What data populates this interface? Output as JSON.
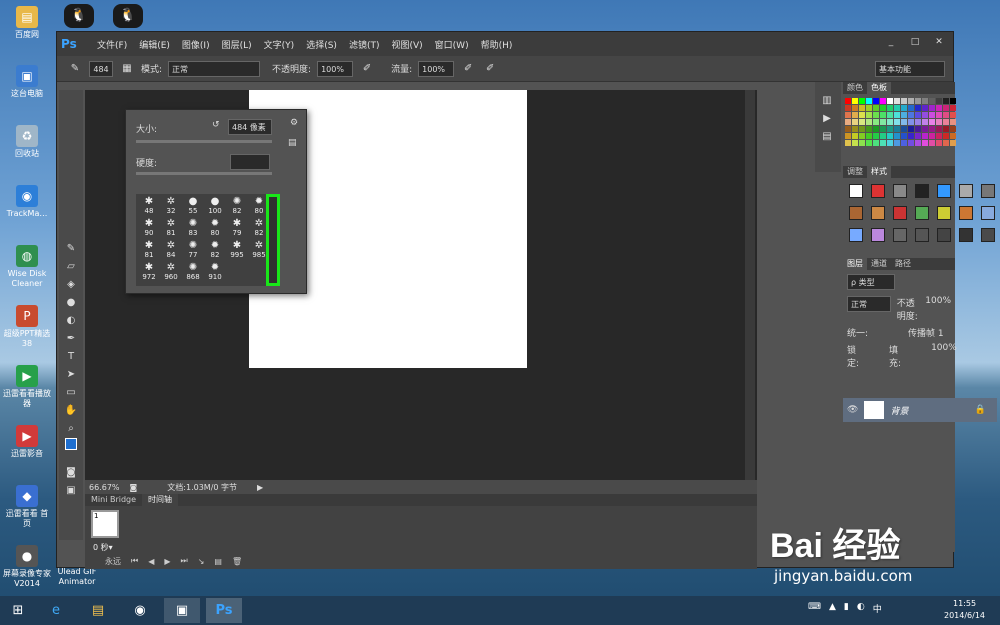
{
  "desktop": {
    "top_icons": [
      "qq-icon",
      "qq-icon"
    ],
    "icons": [
      {
        "label": "百度网",
        "icon": "folder-icon"
      },
      {
        "label": "这台电脑",
        "icon": "computer-icon"
      },
      {
        "label": "回收站",
        "icon": "recycle-bin-icon"
      },
      {
        "label": "TrackMa…",
        "icon": "app-icon"
      },
      {
        "label": "Wise Disk Cleaner",
        "icon": "app-icon"
      },
      {
        "label": "超级PPT精选 38",
        "icon": "app-icon"
      },
      {
        "label": "迅雷看看播放器",
        "icon": "app-icon"
      },
      {
        "label": "迅雷影音",
        "icon": "app-icon"
      },
      {
        "label": "迅雷看看 首页",
        "icon": "app-icon"
      },
      {
        "label": "屏幕录像专家 V2014",
        "icon": "app-icon"
      },
      {
        "label": "Ulead GIF Animator",
        "icon": "app-icon"
      }
    ]
  },
  "ps": {
    "logo": "Ps",
    "menus": [
      "文件(F)",
      "编辑(E)",
      "图像(I)",
      "图层(L)",
      "文字(Y)",
      "选择(S)",
      "滤镜(T)",
      "视图(V)",
      "窗口(W)",
      "帮助(H)"
    ],
    "window_controls": [
      "_",
      "□",
      "✕"
    ],
    "options": {
      "brush_size": "484",
      "mode_label": "模式:",
      "mode_value": "正常",
      "opacity_label": "不透明度:",
      "opacity_value": "100%",
      "flow_label": "流量:",
      "flow_value": "100%",
      "workspace": "基本功能"
    },
    "brush_popup": {
      "size_label": "大小:",
      "size_value": "484 像素",
      "hardness_label": "硬度:",
      "brushes": [
        "48",
        "32",
        "55",
        "100",
        "82",
        "80",
        "90",
        "81",
        "83",
        "80",
        "79",
        "82",
        "81",
        "84",
        "77",
        "82",
        "995",
        "985",
        "972",
        "960",
        "868",
        "910"
      ]
    },
    "status": {
      "zoom": "66.67%",
      "doc": "文档:1.03M/0 字节"
    },
    "bottom_tabs": [
      "Mini Bridge",
      "时间轴"
    ],
    "timeline": {
      "frame_num": "1",
      "delay": "0 秒▾",
      "loop": "永远"
    },
    "right": {
      "color_tabs": [
        "颜色",
        "色板"
      ],
      "adjust_tabs": [
        "调整",
        "样式"
      ],
      "layer_tabs": [
        "图层",
        "通道",
        "路径"
      ],
      "kind": "ρ 类型",
      "blend": "正常",
      "opacity_label": "不透明度:",
      "opacity_value": "100%",
      "unify": "统一:",
      "propagate": "传播帧 1",
      "lock": "锁定:",
      "fill_label": "填充:",
      "fill_value": "100%",
      "layer_name": "背景"
    }
  },
  "taskbar": {
    "time": "11:55",
    "date": "2014/6/14",
    "ime": "中"
  },
  "watermark": {
    "brand": "Bai 经验",
    "url": "jingyan.baidu.com"
  }
}
